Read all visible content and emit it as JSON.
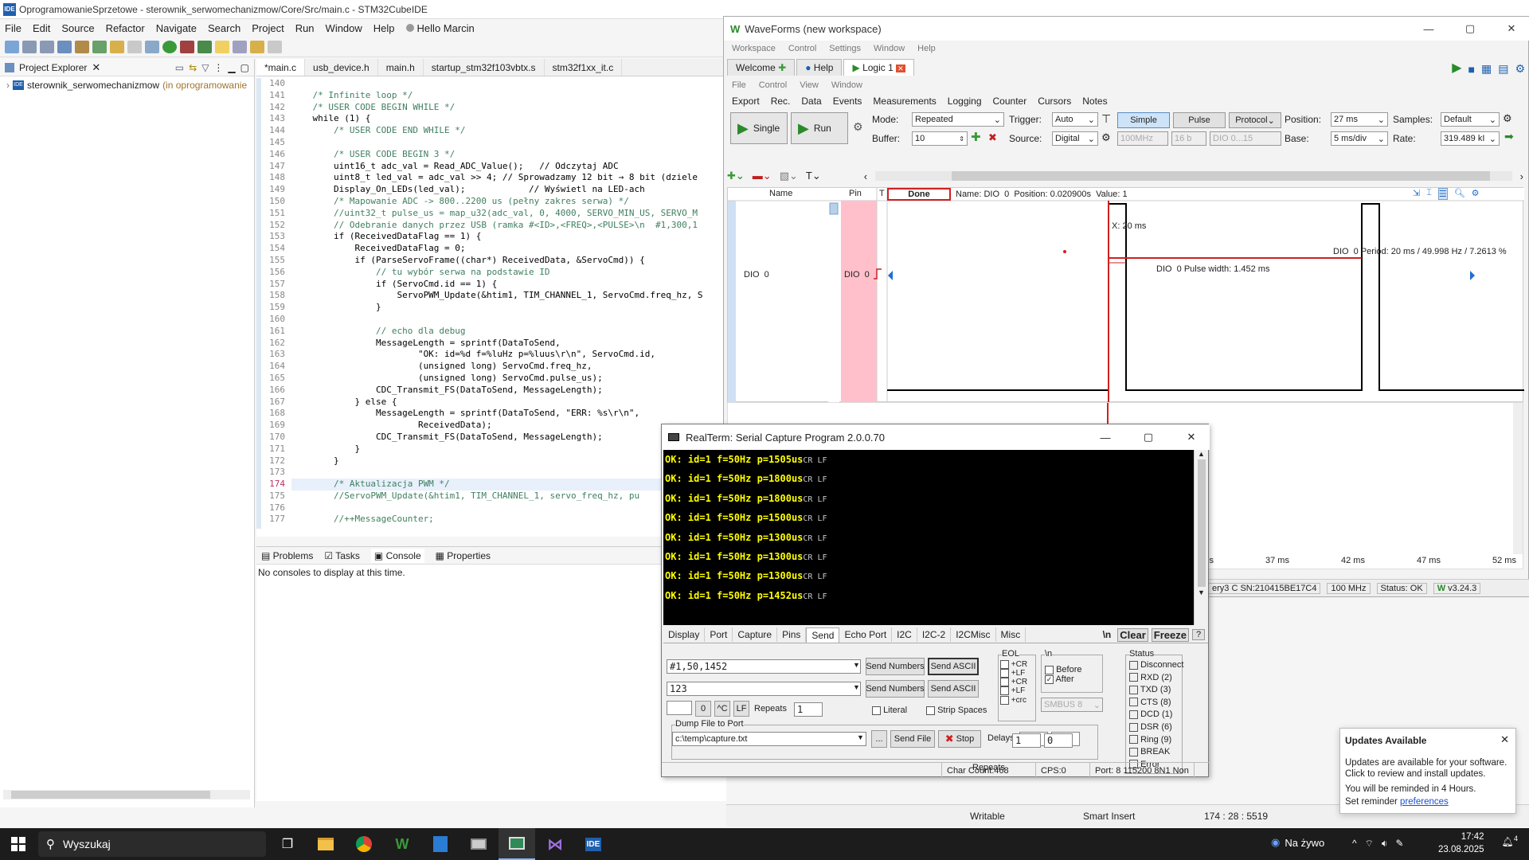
{
  "ide": {
    "title": "OprogramowanieSprzetowe - sterownik_serwomechanizmow/Core/Src/main.c - STM32CubeIDE",
    "logo_text": "IDE",
    "menu": [
      "File",
      "Edit",
      "Source",
      "Refactor",
      "Navigate",
      "Search",
      "Project",
      "Run",
      "Window",
      "Help",
      "Hello Marcin"
    ],
    "explorer_title": "Project Explorer",
    "project_name": "sterownik_serwomechanizmow",
    "project_suffix": "(in oprogramowanie",
    "tabs": [
      "*main.c",
      "usb_device.h",
      "main.h",
      "startup_stm32f103vbtx.s",
      "stm32f1xx_it.c"
    ],
    "code_lines": [
      {
        "n": "140",
        "t": ""
      },
      {
        "n": "141",
        "t": "    /* Infinite loop */"
      },
      {
        "n": "142",
        "t": "    /* USER CODE BEGIN WHILE */"
      },
      {
        "n": "143",
        "t": "    while (1) {"
      },
      {
        "n": "144",
        "t": "        /* USER CODE END WHILE */"
      },
      {
        "n": "145",
        "t": ""
      },
      {
        "n": "146",
        "t": "        /* USER CODE BEGIN 3 */"
      },
      {
        "n": "147",
        "t": "        uint16_t adc_val = Read_ADC_Value();   // Odczytaj ADC"
      },
      {
        "n": "148",
        "t": "        uint8_t led_val = adc_val >> 4; // Sprowadzamy 12 bit → 8 bit (dziele"
      },
      {
        "n": "149",
        "t": "        Display_On_LEDs(led_val);            // Wyświetl na LED-ach"
      },
      {
        "n": "150",
        "t": "        /* Mapowanie ADC -> 800..2200 us (pełny zakres serwa) */"
      },
      {
        "n": "151",
        "t": "        //uint32_t pulse_us = map_u32(adc_val, 0, 4000, SERVO_MIN_US, SERVO_M"
      },
      {
        "n": "152",
        "t": "        // Odebranie danych przez USB (ramka #<ID>,<FREQ>,<PULSE>\\n  #1,300,1"
      },
      {
        "n": "153",
        "t": "        if (ReceivedDataFlag == 1) {"
      },
      {
        "n": "154",
        "t": "            ReceivedDataFlag = 0;"
      },
      {
        "n": "155",
        "t": "            if (ParseServoFrame((char*) ReceivedData, &ServoCmd)) {"
      },
      {
        "n": "156",
        "t": "                // tu wybór serwa na podstawie ID"
      },
      {
        "n": "157",
        "t": "                if (ServoCmd.id == 1) {"
      },
      {
        "n": "158",
        "t": "                    ServoPWM_Update(&htim1, TIM_CHANNEL_1, ServoCmd.freq_hz, S"
      },
      {
        "n": "159",
        "t": "                }"
      },
      {
        "n": "160",
        "t": ""
      },
      {
        "n": "161",
        "t": "                // echo dla debug"
      },
      {
        "n": "162",
        "t": "                MessageLength = sprintf(DataToSend,"
      },
      {
        "n": "163",
        "t": "                        \"OK: id=%d f=%luHz p=%luus\\r\\n\", ServoCmd.id,"
      },
      {
        "n": "164",
        "t": "                        (unsigned long) ServoCmd.freq_hz,"
      },
      {
        "n": "165",
        "t": "                        (unsigned long) ServoCmd.pulse_us);"
      },
      {
        "n": "166",
        "t": "                CDC_Transmit_FS(DataToSend, MessageLength);"
      },
      {
        "n": "167",
        "t": "            } else {"
      },
      {
        "n": "168",
        "t": "                MessageLength = sprintf(DataToSend, \"ERR: %s\\r\\n\","
      },
      {
        "n": "169",
        "t": "                        ReceivedData);"
      },
      {
        "n": "170",
        "t": "                CDC_Transmit_FS(DataToSend, MessageLength);"
      },
      {
        "n": "171",
        "t": "            }"
      },
      {
        "n": "172",
        "t": "        }"
      },
      {
        "n": "173",
        "t": ""
      },
      {
        "n": "174",
        "t": "        /* Aktualizacja PWM */"
      },
      {
        "n": "175",
        "t": "        //ServoPWM_Update(&htim1, TIM_CHANNEL_1, servo_freq_hz, pu"
      },
      {
        "n": "176",
        "t": ""
      },
      {
        "n": "177",
        "t": "        //++MessageCounter;"
      }
    ],
    "console_tabs": [
      "Problems",
      "Tasks",
      "Console",
      "Properties"
    ],
    "console_text": "No consoles to display at this time.",
    "status": {
      "writable": "Writable",
      "insert": "Smart Insert",
      "position": "174 : 28 : 5519"
    }
  },
  "waveforms": {
    "title": "WaveForms (new workspace)",
    "menu": [
      "Workspace",
      "Control",
      "Settings",
      "Window",
      "Help"
    ],
    "tabs": [
      "Welcome",
      "Help",
      "Logic 1"
    ],
    "submenu": [
      "File",
      "Control",
      "View",
      "Window"
    ],
    "submenu2": [
      "Export",
      "Rec.",
      "Data",
      "Events",
      "Measurements",
      "Logging",
      "Counter",
      "Cursors",
      "Notes"
    ],
    "single_label": "Single",
    "run_label": "Run",
    "mode_label": "Mode:",
    "mode_value": "Repeated",
    "trigger_label": "Trigger:",
    "trigger_value": "Auto",
    "mode_buttons": [
      "Simple",
      "Pulse",
      "Protocol"
    ],
    "position_label": "Position:",
    "position_value": "27 ms",
    "samples_label": "Samples:",
    "samples_value": "Default",
    "buffer_label": "Buffer:",
    "buffer_value": "10",
    "source_label": "Source:",
    "source_value": "Digital",
    "clock_value": "100MHz",
    "bits_value": "16 b",
    "dio_value": "DIO 0...15",
    "base_label": "Base:",
    "base_value": "5 ms/div",
    "rate_label": "Rate:",
    "rate_value": "319.489 kI",
    "col_name": "Name",
    "col_pin": "Pin",
    "col_t": "T",
    "done_label": "Done",
    "info": "Name: DIO  0  Position: 0.020900s  Value: 1",
    "signal_name": "DIO  0",
    "signal_pin": "DIO  0",
    "cursor_x": "X: 20 ms",
    "pulse_width": "DIO  0 Pulse width: 1.452 ms",
    "period": "DIO  0 Period: 20 ms / 49.998 Hz / 7.2613 %",
    "time_ticks": [
      "32 ms",
      "37 ms",
      "42 ms",
      "47 ms",
      "52 ms"
    ],
    "device": "ery3 C SN:210415BE17C4",
    "freq": "100 MHz",
    "status": "Status: OK",
    "version": "v3.24.3",
    "accent": "#e02020"
  },
  "realterm": {
    "title": "RealTerm: Serial Capture Program 2.0.0.70",
    "lines": [
      "OK: id=1 f=50Hz p=1505us",
      "OK: id=1 f=50Hz p=1800us",
      "OK: id=1 f=50Hz p=1800us",
      "OK: id=1 f=50Hz p=1500us",
      "OK: id=1 f=50Hz p=1300us",
      "OK: id=1 f=50Hz p=1300us",
      "OK: id=1 f=50Hz p=1300us",
      "OK: id=1 f=50Hz p=1452us"
    ],
    "eol_mark": "CR LF",
    "tabs": [
      "Display",
      "Port",
      "Capture",
      "Pins",
      "Send",
      "Echo Port",
      "I2C",
      "I2C-2",
      "I2CMisc",
      "Misc"
    ],
    "tab_actions": [
      "\\n",
      "Clear",
      "Freeze",
      "?"
    ],
    "send_input1": "#1,50,1452",
    "send_input2": "123",
    "send_numbers": "Send Numbers",
    "send_ascii": "Send ASCII",
    "small_btns": [
      "0",
      "^C",
      "LF"
    ],
    "repeats_label": "Repeats",
    "repeats_value": "1",
    "literal": "Literal",
    "strip_spaces": "Strip Spaces",
    "eol_title": "EOL",
    "eol_opts1": [
      "+CR",
      "+LF"
    ],
    "eol_opts2": [
      "+CR",
      "+LF",
      "+crc"
    ],
    "nl_title": "\\n",
    "before": "Before",
    "after": "After",
    "smbus": "SMBUS 8",
    "dump_title": "Dump File to Port",
    "dump_file": "c:\\temp\\capture.txt",
    "browse": "...",
    "send_file": "Send File",
    "stop": "Stop",
    "delays_label": "Delays",
    "delay1": "0",
    "delay2": "0",
    "rep2_label": "Repeats",
    "rep2_v1": "1",
    "rep2_v2": "0",
    "status_title": "Status",
    "status_items": [
      "Disconnect",
      "RXD (2)",
      "TXD (3)",
      "CTS (8)",
      "DCD (1)",
      "DSR (6)",
      "Ring (9)",
      "BREAK",
      "Error"
    ],
    "char_count": "Char Count:468",
    "cps": "CPS:0",
    "port": "Port: 8 115200 8N1 Non"
  },
  "updates": {
    "title": "Updates Available",
    "body": "Updates are available for your software. Click to review and install updates.",
    "remind": "You will be reminded in 4 Hours.",
    "set_reminder": "Set reminder",
    "link": "preferences"
  },
  "taskbar": {
    "search": "Wyszukaj",
    "live": "Na żywo",
    "time": "17:42",
    "date": "23.08.2025",
    "notif": "4",
    "ide_icon": "IDE"
  }
}
